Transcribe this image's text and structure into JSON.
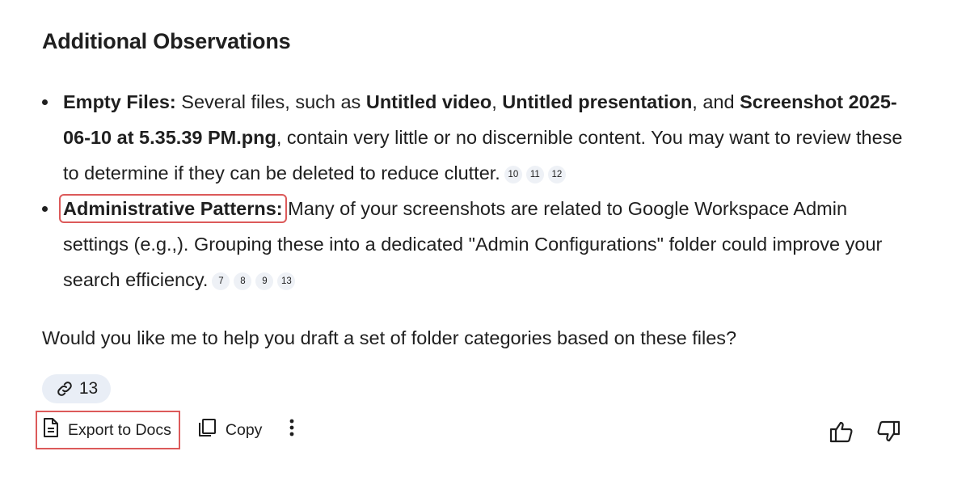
{
  "heading": "Additional Observations",
  "bullets": [
    {
      "label": "Empty Files:",
      "t1": " Several files, such as ",
      "b1": "Untitled video",
      "t2": ", ",
      "b2": "Untitled presentation",
      "t3": ", and ",
      "b3": "Screenshot 2025-06-10 at 5.35.39 PM.png",
      "t4": ", contain very little or no discernible content. You may want to review these to determine if they can be deleted to reduce clutter.",
      "citations": [
        "10",
        "11",
        "12"
      ]
    },
    {
      "label": "Administrative Patterns:",
      "text": " Many of your screenshots are related to Google Workspace Admin settings (e.g.,). Grouping these into a dedicated \"Admin Configurations\" folder could improve your search efficiency.",
      "citations": [
        "7",
        "8",
        "9",
        "13"
      ]
    }
  ],
  "question": "Would you like me to help you draft a set of folder categories based on these files?",
  "sources": {
    "icon": "link-icon",
    "count": "13"
  },
  "actions": {
    "export_label": "Export to Docs",
    "export_icon": "document-icon",
    "copy_label": "Copy",
    "copy_icon": "copy-icon",
    "more_icon": "more-vert-icon"
  },
  "feedback": {
    "up_icon": "thumb-up-icon",
    "down_icon": "thumb-down-icon"
  },
  "colors": {
    "text": "#1f1f1f",
    "highlight_box": "#dc5a5a",
    "chip_bg": "#e9eef6",
    "citation_bg": "#eef1f6"
  }
}
